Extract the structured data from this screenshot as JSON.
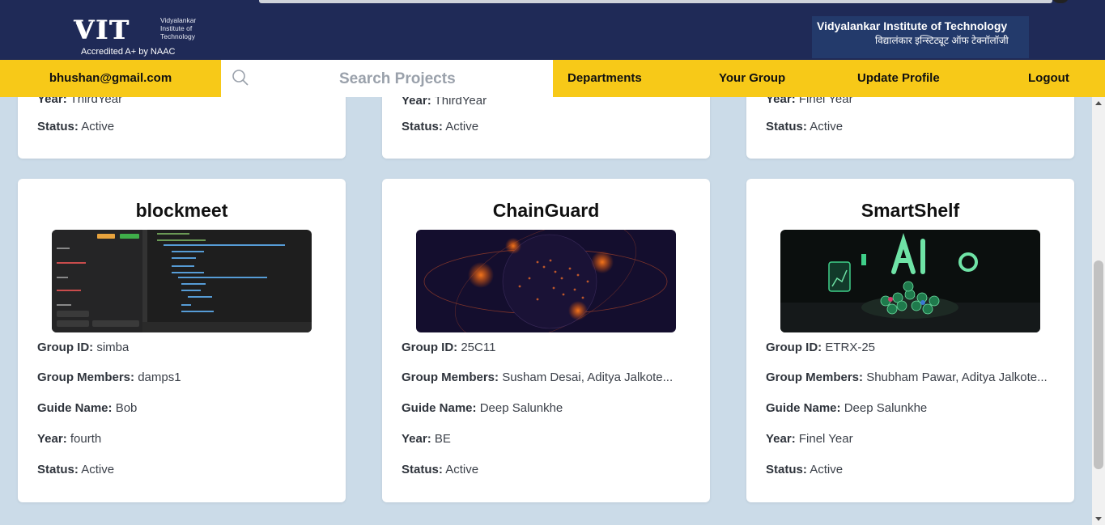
{
  "header": {
    "logo_big": "VIT",
    "logo_small": "Vidyalankar Institute of Technology",
    "logo_naac": "Accredited A+ by NAAC",
    "brand_en": "Vidyalankar Institute of Technology",
    "brand_hi": "विद्यालंकार इन्स्टिट्यूट ऑफ टेक्नॉलॉजी"
  },
  "nav": {
    "email": "bhushan@gmail.com",
    "search_placeholder": "Search Projects",
    "links": [
      "Departments",
      "Your Group",
      "Update Profile",
      "Logout"
    ]
  },
  "labels": {
    "group_id": "Group ID:",
    "group_members": "Group Members:",
    "guide_name": "Guide Name:",
    "year": "Year:",
    "status": "Status:"
  },
  "top_cards": [
    {
      "year": "ThirdYear",
      "status": "Active"
    },
    {
      "year": "ThirdYear",
      "status": "Active"
    },
    {
      "year": "Finel Year",
      "status": "Active"
    }
  ],
  "projects": [
    {
      "title": "blockmeet",
      "group_id": "simba",
      "members": "damps1",
      "guide": "Bob",
      "year": "fourth",
      "status": "Active",
      "image": "code-editor-screenshot"
    },
    {
      "title": "ChainGuard",
      "group_id": "25C11",
      "members": "Susham Desai, Aditya Jalkote...",
      "guide": "Deep Salunkhe",
      "year": "BE",
      "status": "Active",
      "image": "glowing-globe-network"
    },
    {
      "title": "SmartShelf",
      "group_id": "ETRX-25",
      "members": "Shubham Pawar, Aditya Jalkote...",
      "guide": "Deep Salunkhe",
      "year": "Finel Year",
      "status": "Active",
      "image": "ai-coins-illustration"
    }
  ],
  "colors": {
    "header_bg": "#1f2a57",
    "nav_bg": "#f7c918",
    "page_bg": "#cbdbe8"
  }
}
